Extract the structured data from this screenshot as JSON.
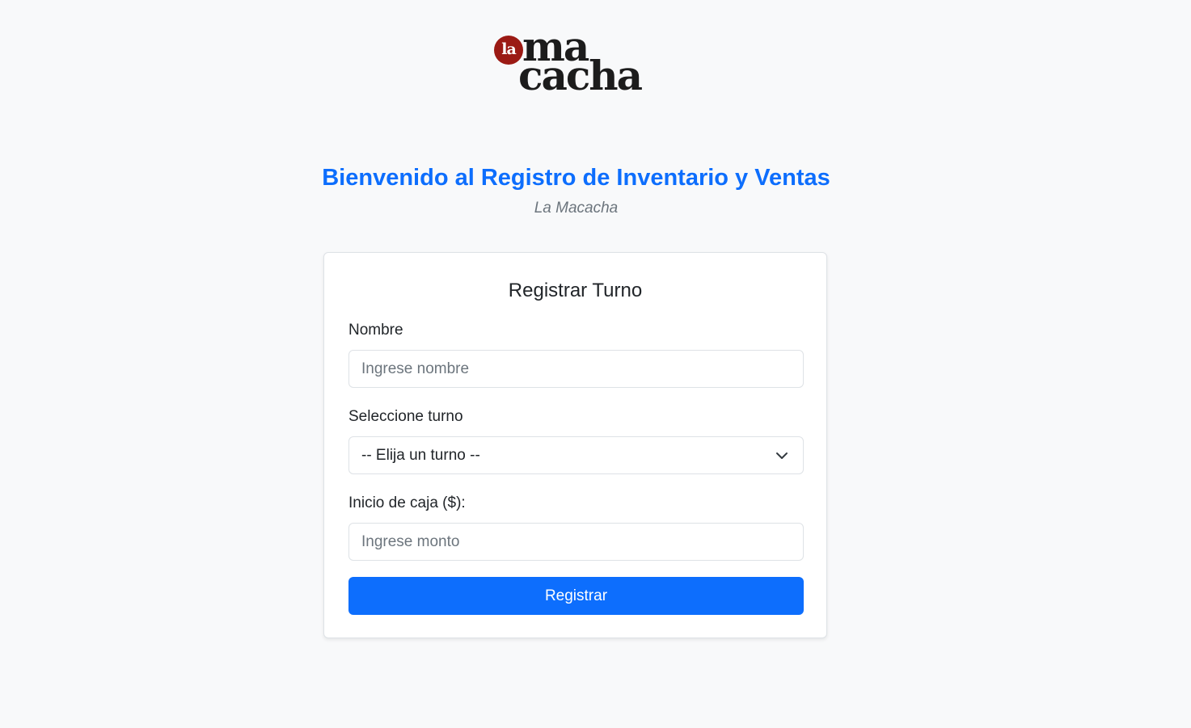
{
  "logo": {
    "badge_text": "la",
    "line1": "ma",
    "line2": "cacha",
    "badge_color": "#9b1a14"
  },
  "header": {
    "title": "Bienvenido al Registro de Inventario y Ventas",
    "subtitle": "La Macacha",
    "title_color": "#0d6efd"
  },
  "form": {
    "title": "Registrar Turno",
    "name": {
      "label": "Nombre",
      "placeholder": "Ingrese nombre",
      "value": ""
    },
    "shift": {
      "label": "Seleccione turno",
      "selected": "-- Elija un turno --",
      "icon": "chevron-down-icon"
    },
    "cash": {
      "label": "Inicio de caja ($):",
      "placeholder": "Ingrese monto",
      "value": ""
    },
    "submit_label": "Registrar",
    "submit_color": "#0d6efd"
  }
}
